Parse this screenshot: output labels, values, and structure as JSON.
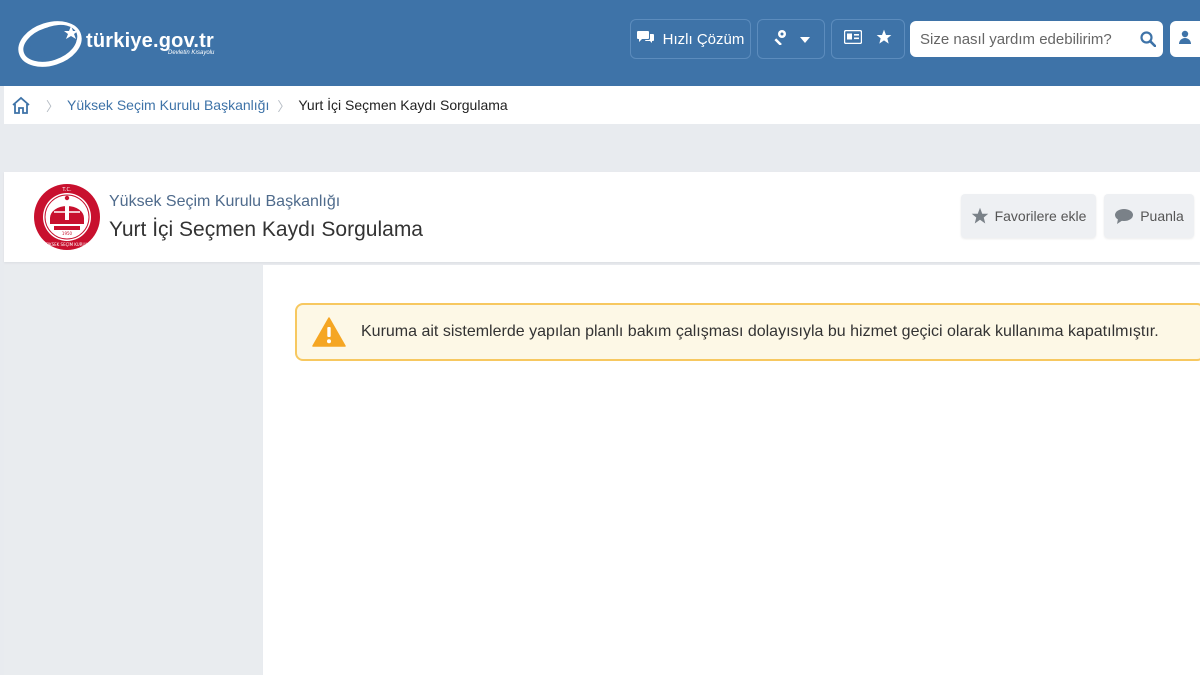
{
  "header": {
    "logo_text": "türkiye.gov.tr",
    "logo_tagline": "Devletin Kısayolu",
    "quick_solution_label": "Hızlı Çözüm",
    "search_placeholder": "Size nasıl yardım edebilirim?"
  },
  "breadcrumb": {
    "items": [
      "Yüksek Seçim Kurulu Başkanlığı",
      "Yurt İçi Seçmen Kaydı Sorgulama"
    ]
  },
  "page": {
    "org_name": "Yüksek Seçim Kurulu Başkanlığı",
    "title": "Yurt İçi Seçmen Kaydı Sorgulama",
    "favorite_label": "Favorilere ekle",
    "rate_label": "Puanla"
  },
  "seal": {
    "top_text": "T.C.",
    "bottom_text": "YÜKSEK SEÇİM KURULU",
    "year": "1950"
  },
  "alert": {
    "message": "Kuruma ait sistemlerde yapılan planlı bakım çalışması dolayısıyla bu hizmet geçici olarak kullanıma kapatılmıştır."
  },
  "colors": {
    "header_bg": "#3e73a8",
    "link": "#3e73a8",
    "alert_border": "#f7c860",
    "alert_bg": "#fdf8e6",
    "warning_icon": "#f5a623",
    "seal_red": "#c8102e"
  }
}
